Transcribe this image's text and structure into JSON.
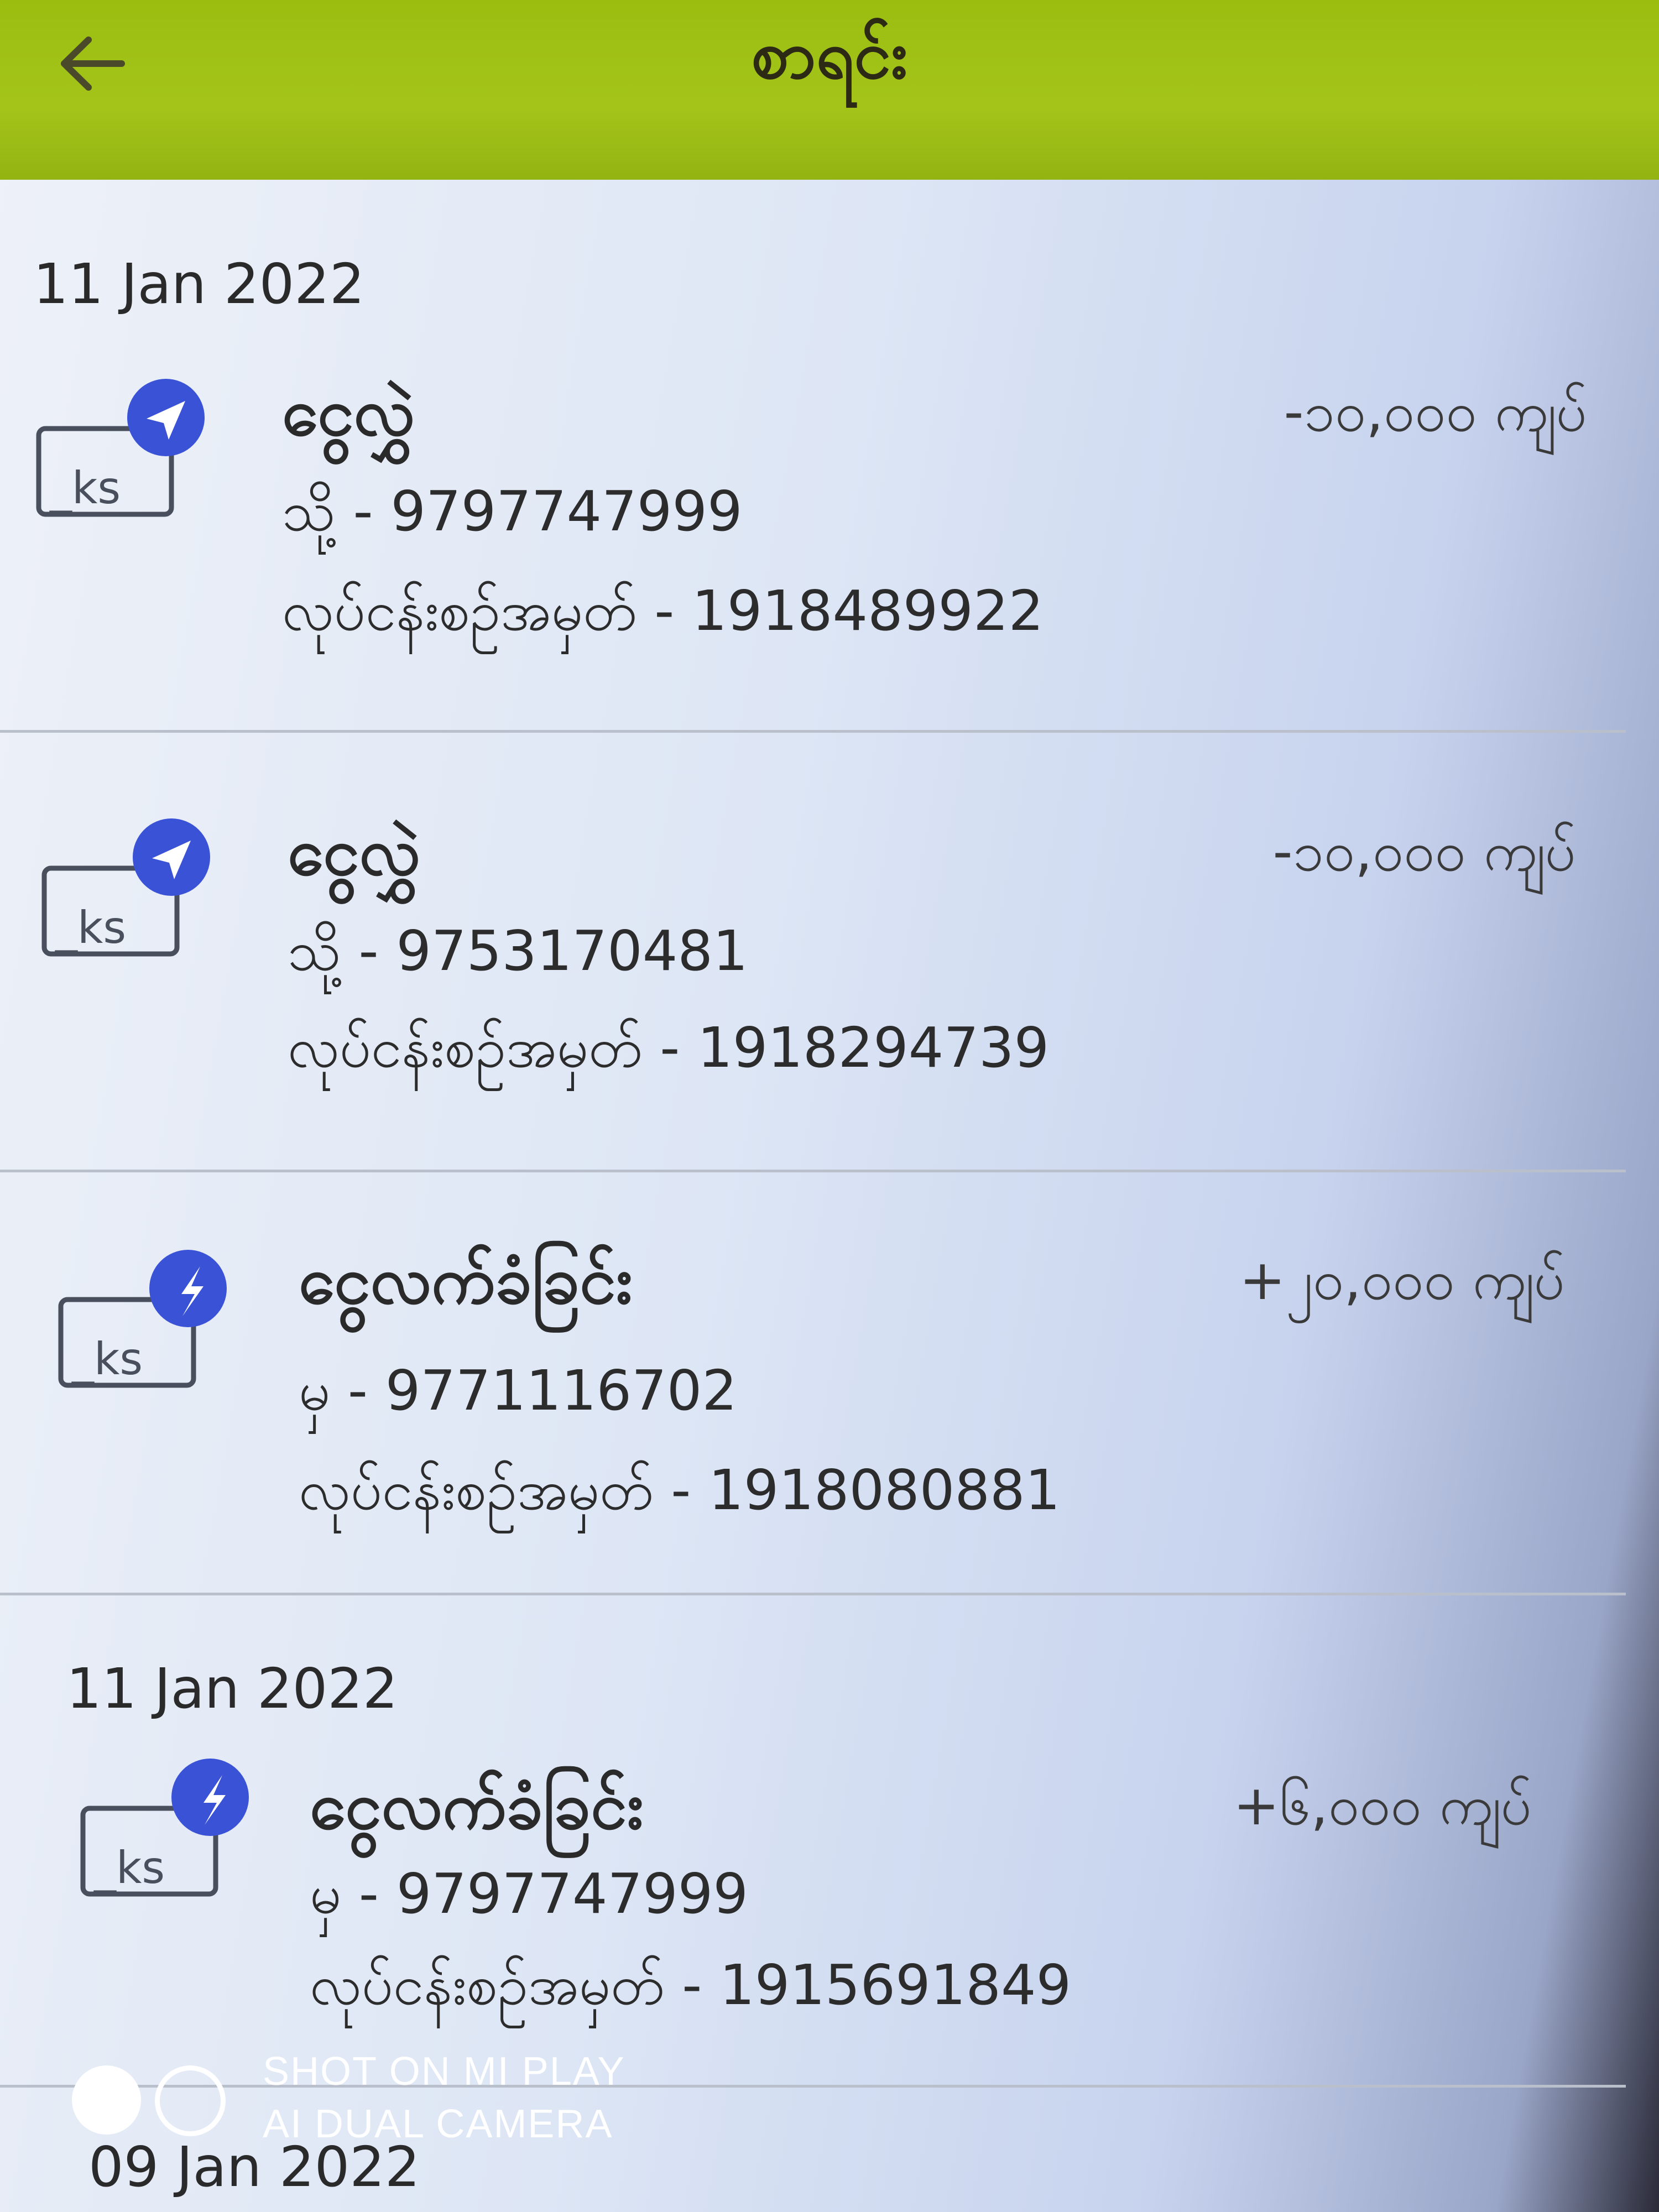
{
  "header": {
    "title": "စာရင်း",
    "back_icon": "arrow-left-icon",
    "background": "#a4c41a"
  },
  "transactions": [
    {
      "date": "11 Jan 2022",
      "type": "ငွေလွှဲ",
      "party_line": "သို့ - 9797747999",
      "txn_line": "လုပ်ငန်းစဉ်အမှတ် - 1918489922",
      "amount": "-၁၀,၀၀၀  ကျပ်",
      "icon": "send-money-icon",
      "badge": "paper-plane-icon"
    },
    {
      "type": "ငွေလွှဲ",
      "party_line": "သို့ - 9753170481",
      "txn_line": "လုပ်ငန်းစဉ်အမှတ် - 1918294739",
      "amount": "-၁၀,၀၀၀  ကျပ်",
      "icon": "send-money-icon",
      "badge": "paper-plane-icon"
    },
    {
      "type": "ငွေလက်ခံခြင်း",
      "party_line": "မှ - 9771116702",
      "txn_line": "လုပ်ငန်းစဉ်အမှတ် - 1918080881",
      "amount": "+၂၀,၀၀၀  ကျပ်",
      "icon": "receive-money-icon",
      "badge": "receive-arrow-icon"
    },
    {
      "date": "11 Jan 2022",
      "type": "ငွေလက်ခံခြင်း",
      "party_line": "မှ - 9797747999",
      "txn_line": "လုပ်ငန်းစဉ်အမှတ် - 1915691849",
      "amount": "+၆,၀၀၀  ကျပ်",
      "icon": "receive-money-icon",
      "badge": "receive-arrow-icon"
    }
  ],
  "next_date": "09 Jan 2022",
  "watermark": {
    "line1": "SHOT ON MI PLAY",
    "line2": "AI DUAL CAMERA"
  },
  "colors": {
    "badge_blue": "#3a52d6",
    "icon_stroke": "#4a4f5e"
  }
}
